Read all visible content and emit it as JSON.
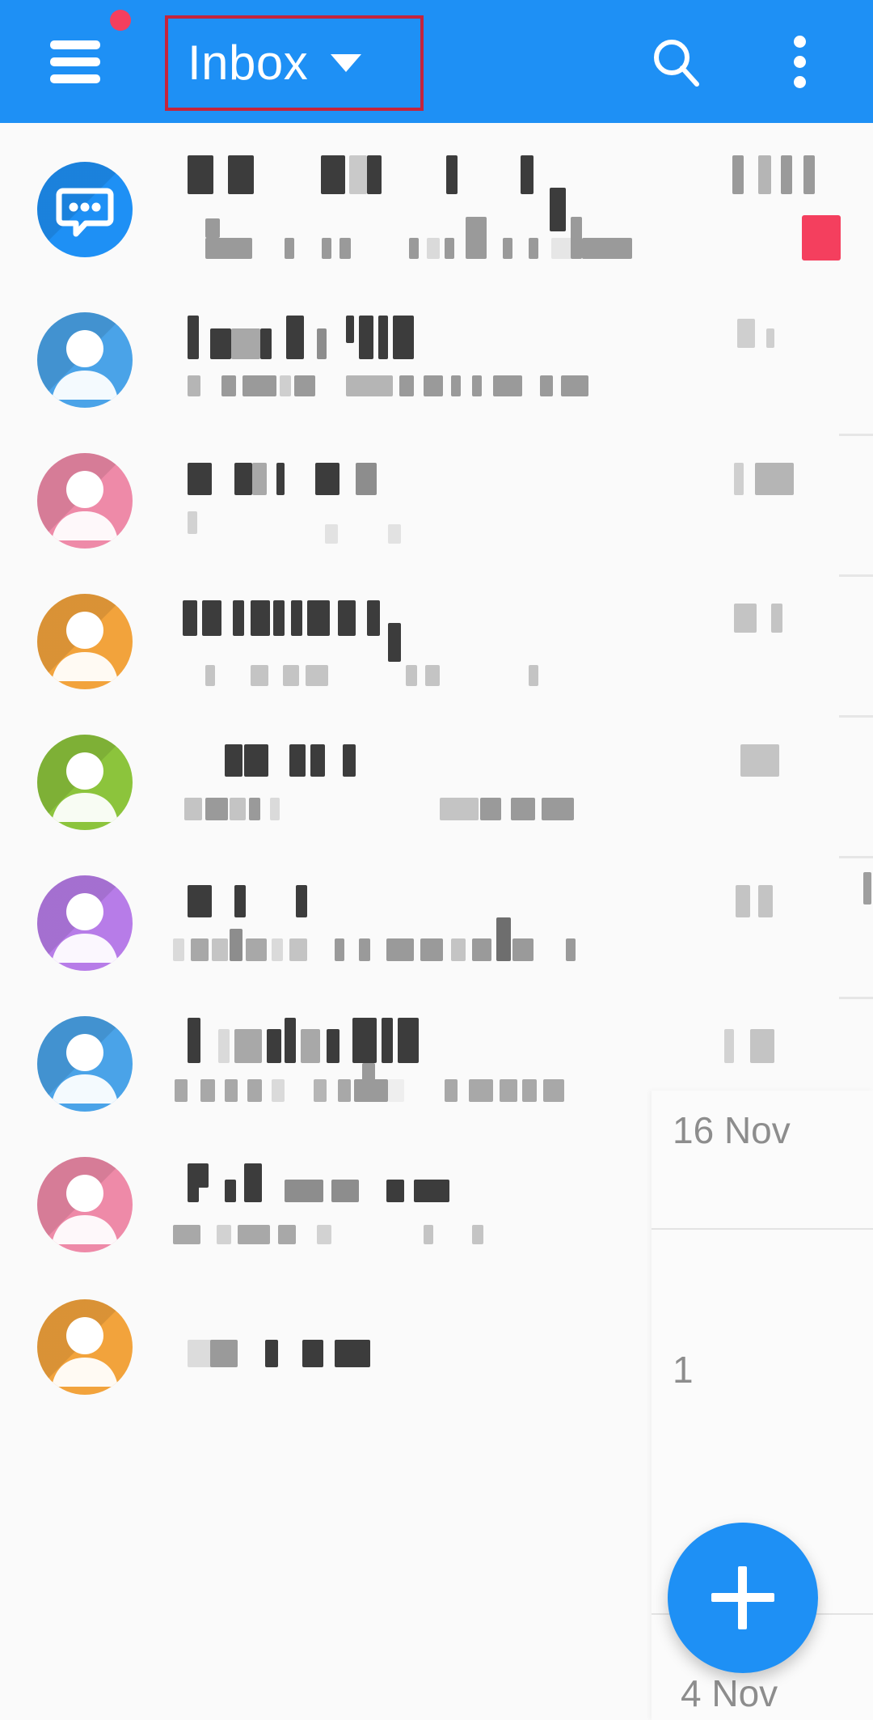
{
  "appbar": {
    "menu_icon": "hamburger-menu-icon",
    "menu_badge": "notification-dot",
    "title": "Inbox",
    "title_caret_icon": "chevron-down-icon",
    "search_icon": "search-icon",
    "overflow_icon": "more-vertical-icon",
    "background_color": "#1e90f5",
    "highlight_box_color": "#c4243c"
  },
  "colors": {
    "accent": "#1e90f5",
    "badge_pink": "#f43f5e",
    "surface": "#fafafa",
    "divider": "#e6e6e6",
    "redaction_dark": "#3a3a3a",
    "redaction_light": "#a8a8a8"
  },
  "fab": {
    "icon": "plus-icon",
    "label": "Compose",
    "color": "#1e90f5"
  },
  "overlay": {
    "dates": [
      "16 Nov",
      "4 Nov"
    ],
    "partial_date": "1"
  },
  "list": {
    "redacted": true,
    "items": [
      {
        "avatar_type": "chat-bubble",
        "avatar_color": "#1e90f5",
        "unread_badge": true,
        "title_redacted": true,
        "subtitle_redacted": true,
        "timestamp_redacted": true
      },
      {
        "avatar_type": "person",
        "avatar_color": "#4aa3e8",
        "unread_badge": false,
        "title_redacted": true,
        "subtitle_redacted": true,
        "timestamp_redacted": true
      },
      {
        "avatar_type": "person",
        "avatar_color": "#ee8aa8",
        "unread_badge": false,
        "title_redacted": true,
        "subtitle_redacted": true,
        "timestamp_redacted": true
      },
      {
        "avatar_type": "person",
        "avatar_color": "#f2a33c",
        "unread_badge": false,
        "title_redacted": true,
        "subtitle_redacted": true,
        "timestamp_redacted": true
      },
      {
        "avatar_type": "person",
        "avatar_color": "#8cc43c",
        "unread_badge": false,
        "title_redacted": true,
        "subtitle_redacted": true,
        "timestamp_redacted": true
      },
      {
        "avatar_type": "person",
        "avatar_color": "#b77ce8",
        "unread_badge": false,
        "title_redacted": true,
        "subtitle_redacted": true,
        "timestamp_redacted": true
      },
      {
        "avatar_type": "person",
        "avatar_color": "#4aa3e8",
        "unread_badge": false,
        "title_redacted": true,
        "subtitle_redacted": true,
        "timestamp_redacted": true
      },
      {
        "avatar_type": "person",
        "avatar_color": "#ee8aa8",
        "unread_badge": false,
        "title_redacted": true,
        "subtitle_redacted": true,
        "timestamp_redacted": true,
        "timestamp": "16 Nov"
      },
      {
        "avatar_type": "person",
        "avatar_color": "#f2a33c",
        "unread_badge": false,
        "title_redacted": true,
        "subtitle_redacted": true,
        "timestamp_redacted": true,
        "timestamp": "4 Nov"
      }
    ]
  }
}
